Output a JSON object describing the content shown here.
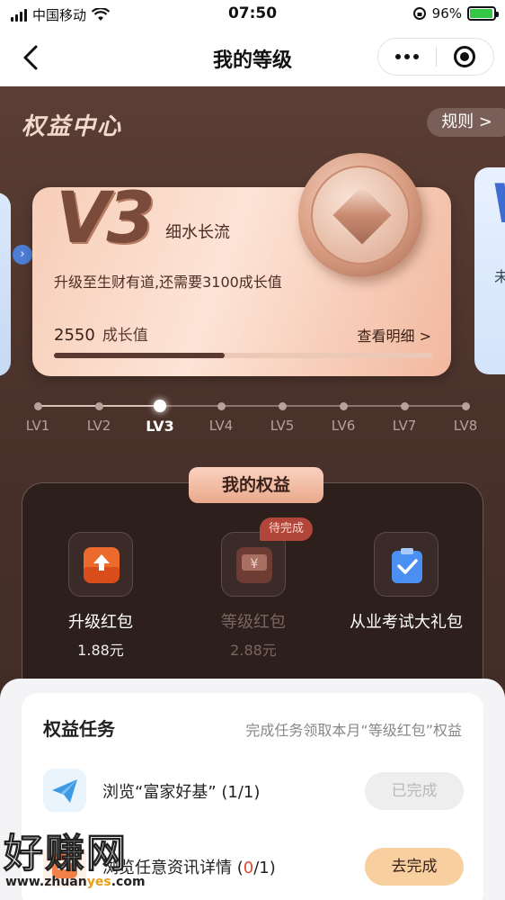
{
  "status_bar": {
    "carrier": "中国移动",
    "time": "07:50",
    "battery": "96%"
  },
  "nav": {
    "title": "我的等级",
    "back_icon": "chevron-left-icon",
    "more_icon": "more-dots-icon",
    "target_icon": "target-icon"
  },
  "header": {
    "center_title": "权益中心",
    "rules_label": "规则 >"
  },
  "level_card": {
    "level": "V3",
    "name": "细水长流",
    "upgrade_desc": "升级至生财有道,还需要3100成长值",
    "growth_value": "2550",
    "growth_unit": "成长值",
    "detail_link": "查看明细 >",
    "progress_fraction": 0.45
  },
  "right_card": {
    "level": "V",
    "text": "未"
  },
  "levels": [
    {
      "label": "LV1",
      "active": false
    },
    {
      "label": "LV2",
      "active": false
    },
    {
      "label": "LV3",
      "active": true
    },
    {
      "label": "LV4",
      "active": false
    },
    {
      "label": "LV5",
      "active": false
    },
    {
      "label": "LV6",
      "active": false
    },
    {
      "label": "LV7",
      "active": false
    },
    {
      "label": "LV8",
      "active": false
    }
  ],
  "benefits": {
    "title": "我的权益",
    "items": [
      {
        "title": "升级红包",
        "amount": "1.88元",
        "icon": "upgrade-redpacket-icon",
        "badge": ""
      },
      {
        "title": "等级红包",
        "amount": "2.88元",
        "icon": "yuan-redpacket-icon",
        "badge": "待完成"
      },
      {
        "title": "从业考试大礼包",
        "amount": "",
        "icon": "clipboard-check-icon",
        "badge": ""
      }
    ]
  },
  "tasks": {
    "title": "权益任务",
    "subtitle": "完成任务领取本月“等级红包”权益",
    "items": [
      {
        "text": "浏览“富家好基” (1/1)",
        "button": "已完成",
        "icon": "paper-plane-icon"
      },
      {
        "text_prefix": "浏览任意资讯详情 (",
        "count": "0",
        "text_suffix": "/1)",
        "button": "去完成",
        "icon": "news-icon"
      }
    ]
  },
  "watermark": {
    "text": "好赚网",
    "url_a": "www.zhuan",
    "url_b": "yes",
    "url_c": ".com"
  },
  "colors": {
    "accent": "#f8cf9f",
    "badge_red": "#b2453a",
    "card_peach": "#fde4d6"
  }
}
